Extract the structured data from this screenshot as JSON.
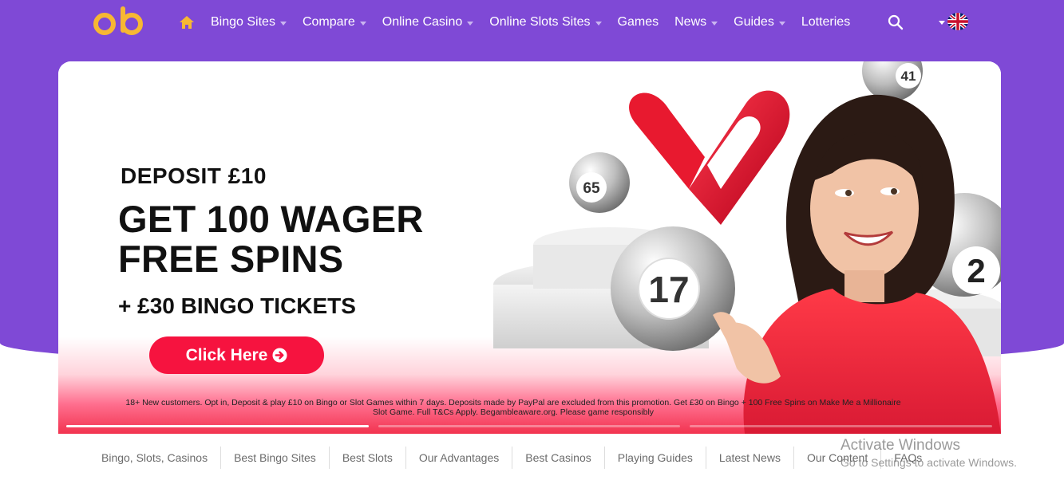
{
  "header": {
    "logo_text": "ob",
    "nav_items": [
      {
        "label": "Bingo Sites",
        "has_dropdown": true
      },
      {
        "label": "Compare",
        "has_dropdown": true
      },
      {
        "label": "Online Casino",
        "has_dropdown": true
      },
      {
        "label": "Online Slots Sites",
        "has_dropdown": true
      },
      {
        "label": "Games",
        "has_dropdown": false
      },
      {
        "label": "News",
        "has_dropdown": true
      },
      {
        "label": "Guides",
        "has_dropdown": true
      },
      {
        "label": "Lotteries",
        "has_dropdown": false
      }
    ],
    "icons": {
      "home": "home-icon",
      "search": "search-icon",
      "language": "uk-flag-icon"
    }
  },
  "banner": {
    "line1": "DEPOSIT £10",
    "line2": "GET 100 WAGER",
    "line3": "FREE SPINS",
    "line4": "+ £30 BINGO TICKETS",
    "cta_label": "Click Here",
    "terms": "18+ New customers. Opt in, Deposit & play £10 on Bingo or Slot Games within 7 days. Deposits made by PayPal are excluded from this promotion. Get £30 on Bingo + 100 Free Spins on Make Me a Millionaire Slot Game. Full T&Cs Apply. Begambleaware.org. Please game responsibly",
    "ball_numbers": [
      "41",
      "65",
      "17",
      "2"
    ],
    "slides_total": 3,
    "active_slide": 1
  },
  "subnav": {
    "items": [
      "Bingo, Slots, Casinos",
      "Best Bingo Sites",
      "Best Slots",
      "Our Advantages",
      "Best Casinos",
      "Playing Guides",
      "Latest News",
      "Our Content",
      "FAQs"
    ]
  },
  "watermark": {
    "title": "Activate Windows",
    "subtitle": "Go to Settings to activate Windows."
  },
  "colors": {
    "header_bg": "#7f49d6",
    "logo": "#f7b733",
    "cta": "#f6133f",
    "banner_bottom": "#f2334f"
  }
}
